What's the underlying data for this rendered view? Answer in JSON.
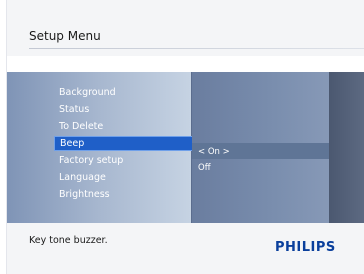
{
  "header": {
    "title": "Setup Menu"
  },
  "menu": {
    "items": [
      {
        "label": "Background",
        "selected": false
      },
      {
        "label": "Status",
        "selected": false
      },
      {
        "label": "To Delete",
        "selected": false
      },
      {
        "label": "Beep",
        "selected": true
      },
      {
        "label": "Factory setup",
        "selected": false
      },
      {
        "label": "Language",
        "selected": false
      },
      {
        "label": "Brightness",
        "selected": false
      }
    ]
  },
  "submenu": {
    "options": [
      {
        "label": "< On >",
        "selected": true
      },
      {
        "label": "Off",
        "selected": false
      }
    ]
  },
  "footer": {
    "help_text": "Key tone buzzer.",
    "brand": "PHILIPS"
  },
  "colors": {
    "selection": "#1f5fc8",
    "brand": "#0a3f9c"
  }
}
